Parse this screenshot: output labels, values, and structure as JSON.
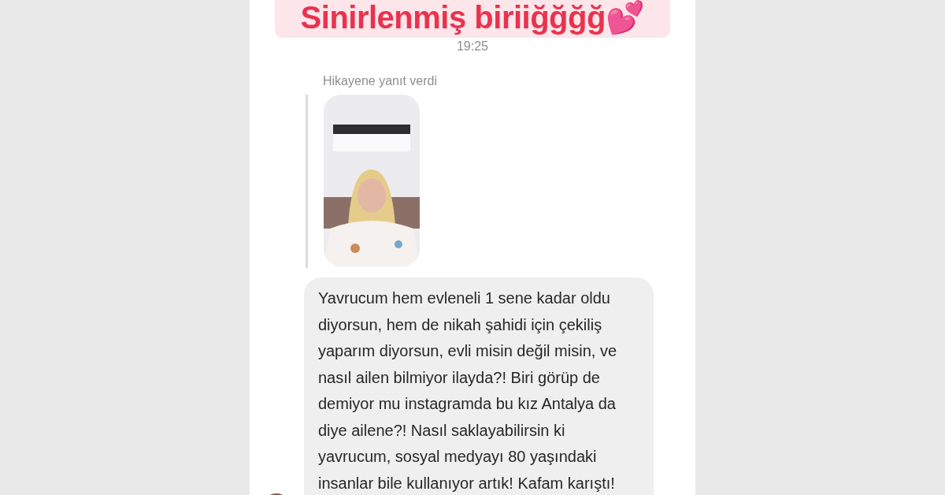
{
  "header": {
    "title": "Sinirlenmiş biriiğğğğ💕"
  },
  "timestamp": "19:25",
  "story_reply": {
    "label": "Hikayene yanıt verdi"
  },
  "message": {
    "text": "Yavrucum hem evleneli 1 sene kadar oldu diyorsun, hem de nikah şahidi için çekiliş yaparım diyorsun, evli misin değil misin, ve nasıl ailen bilmiyor ilayda?! Biri görüp de demiyor mu instagramda bu kız Antalya da diye ailene?! Nasıl saklayabilirsin ki yavrucum, sosyal medyayı 80 yaşındaki insanlar bile kullanıyor artık! Kafam karıştı!"
  }
}
